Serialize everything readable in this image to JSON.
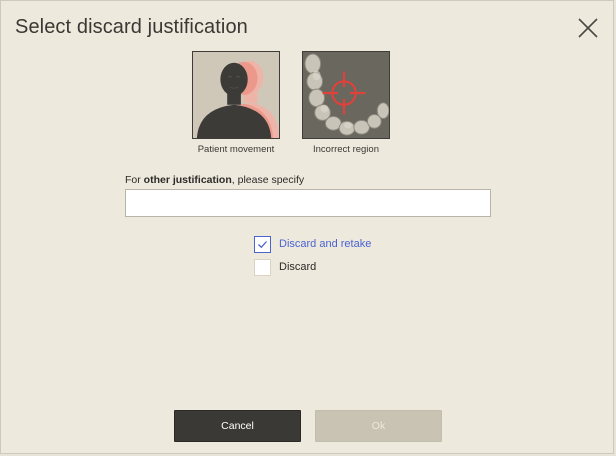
{
  "dialog": {
    "title": "Select discard justification"
  },
  "options": [
    {
      "caption": "Patient movement",
      "icon": "patient-movement-icon"
    },
    {
      "caption": "Incorrect region",
      "icon": "incorrect-region-icon"
    }
  ],
  "other_justification": {
    "label_prefix": "For ",
    "label_bold": "other justification",
    "label_suffix": ", please specify",
    "value": "",
    "placeholder": ""
  },
  "checkboxes": [
    {
      "label": "Discard and retake",
      "checked": true
    },
    {
      "label": "Discard",
      "checked": false
    }
  ],
  "buttons": {
    "cancel": "Cancel",
    "ok": "Ok"
  },
  "colors": {
    "background": "#ede9dd",
    "accent": "#4b63d1",
    "primary_button": "#3b3935",
    "disabled_button": "#c9c3b3",
    "target_red": "#e0413b"
  }
}
